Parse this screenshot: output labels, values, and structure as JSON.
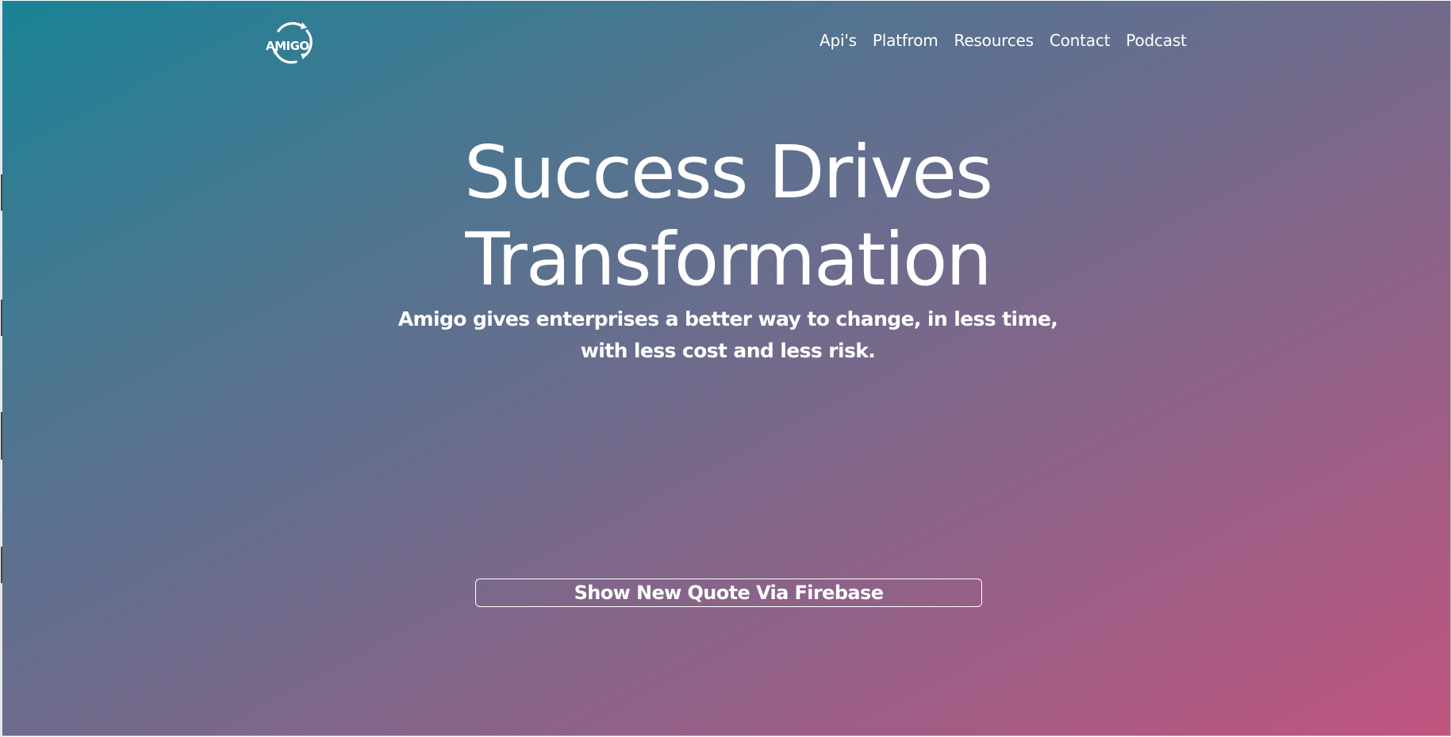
{
  "brand": {
    "logo_text": "AMIGO"
  },
  "nav": {
    "items": [
      {
        "label": "Api's"
      },
      {
        "label": "Platfrom"
      },
      {
        "label": "Resources"
      },
      {
        "label": "Contact"
      },
      {
        "label": "Podcast"
      }
    ]
  },
  "hero": {
    "title_line1": "Success Drives",
    "title_line2": "Transformation",
    "subtitle_line1": "Amigo gives enterprises a better way to change, in less time,",
    "subtitle_line2": "with less cost and less risk."
  },
  "cta": {
    "quote_button_label": "Show New Quote Via Firebase"
  },
  "colors": {
    "gradient_start": "#1a8397",
    "gradient_end": "#c0557f",
    "text": "#ffffff"
  },
  "icons": {
    "logo": "circular-arrows-icon"
  }
}
